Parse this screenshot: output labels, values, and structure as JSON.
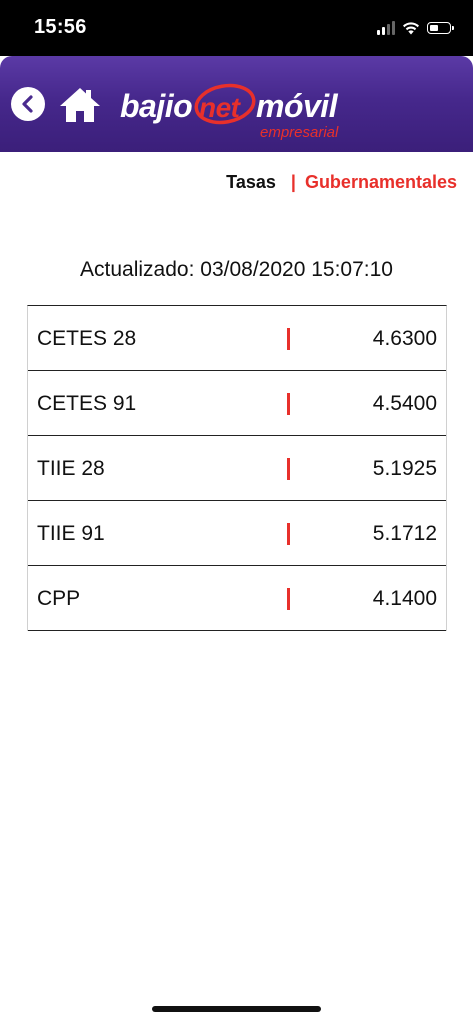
{
  "status_bar": {
    "time": "15:56",
    "icons": [
      "cellular-signal-icon",
      "wifi-icon",
      "battery-icon"
    ]
  },
  "header": {
    "back_icon": "chevron-left-icon",
    "home_icon": "home-icon",
    "logo": {
      "bajio": "bajio",
      "net": "net",
      "movil": "móvil",
      "empresarial": "empresarial"
    }
  },
  "breadcrumb": {
    "parent": "Tasas",
    "separator": "|",
    "current": "Gubernamentales"
  },
  "updated_text": "Actualizado: 03/08/2020 15:07:10",
  "rates": [
    {
      "name": "CETES 28",
      "value": "4.6300"
    },
    {
      "name": "CETES 91",
      "value": "4.5400"
    },
    {
      "name": "TIIE 28",
      "value": "5.1925"
    },
    {
      "name": "TIIE 91",
      "value": "5.1712"
    },
    {
      "name": "CPP",
      "value": "4.1400"
    }
  ],
  "colors": {
    "header_purple": "#46288c",
    "accent_red": "#e8302b",
    "text": "#111111",
    "background": "#ffffff"
  }
}
